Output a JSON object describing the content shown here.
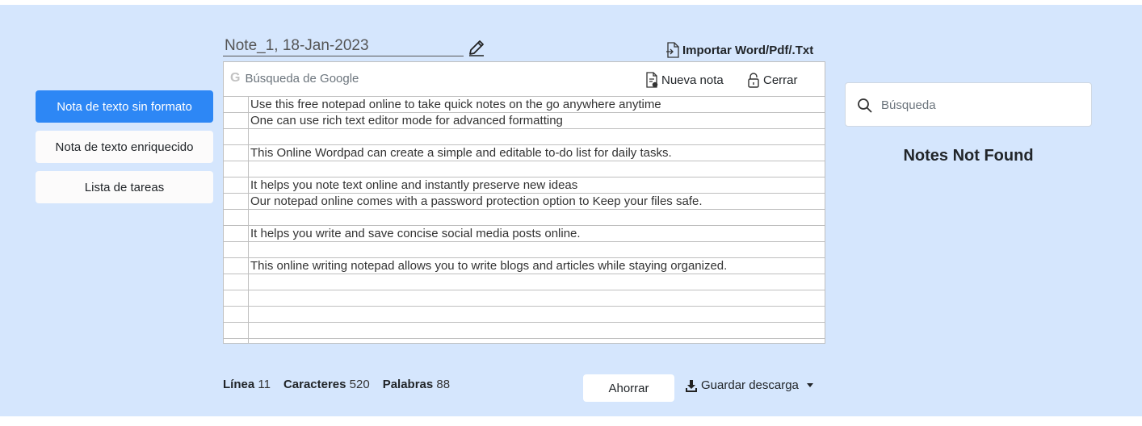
{
  "modes": {
    "plain": "Nota de texto sin formato",
    "rich": "Nota de texto enriquecido",
    "todo": "Lista de tareas"
  },
  "note": {
    "title": "Note_1, 18-Jan-2023"
  },
  "import_label": "Importar Word/Pdf/.Txt",
  "toolbar": {
    "google_placeholder": "Búsqueda de Google",
    "new_note": "Nueva nota",
    "close": "Cerrar"
  },
  "editor": {
    "lines": [
      "Use this free notepad online to take quick notes on the go anywhere anytime",
      "One can use rich text editor mode for advanced formatting",
      "",
      "This Online Wordpad can create a simple and editable to-do list for daily tasks.",
      "",
      "It helps you note text online and instantly preserve new ideas",
      "Our notepad online comes with a password protection option to Keep your files safe.",
      "",
      "It helps you write and save concise social media posts online.",
      "",
      "This online writing notepad allows you to write blogs and articles while staying organized.",
      "",
      "",
      "",
      "",
      ""
    ]
  },
  "stats": {
    "line_label": "Línea",
    "line_value": "11",
    "chars_label": "Caracteres",
    "chars_value": "520",
    "words_label": "Palabras",
    "words_value": "88"
  },
  "actions": {
    "save": "Ahorrar",
    "download": "Guardar descarga"
  },
  "search": {
    "placeholder": "Búsqueda"
  },
  "notes_empty": "Notes Not Found",
  "colors": {
    "background": "#d5e6fd",
    "active_button": "#2d87f5"
  }
}
